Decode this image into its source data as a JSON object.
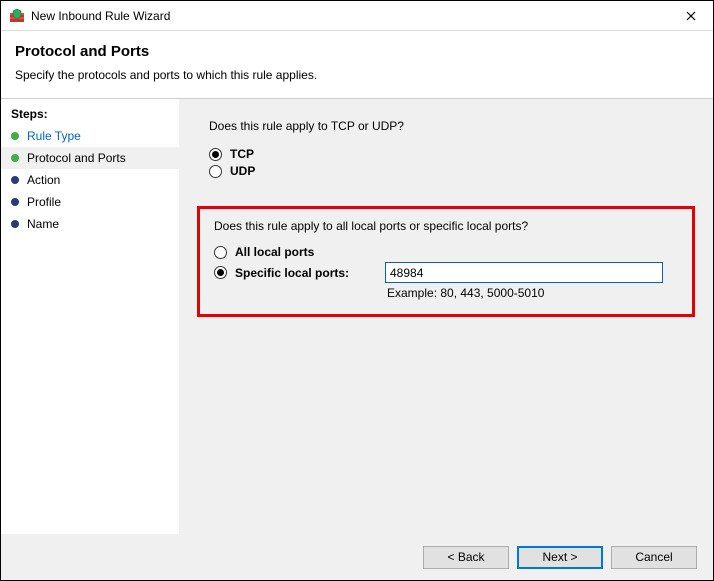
{
  "window": {
    "title": "New Inbound Rule Wizard"
  },
  "header": {
    "title": "Protocol and Ports",
    "subtitle": "Specify the protocols and ports to which this rule applies."
  },
  "sidebar": {
    "heading": "Steps:",
    "items": [
      {
        "label": "Rule Type",
        "state": "done",
        "link": true
      },
      {
        "label": "Protocol and Ports",
        "state": "done",
        "current": true
      },
      {
        "label": "Action",
        "state": "todo"
      },
      {
        "label": "Profile",
        "state": "todo"
      },
      {
        "label": "Name",
        "state": "todo"
      }
    ]
  },
  "main": {
    "q1": "Does this rule apply to TCP or UDP?",
    "protocol": {
      "tcp": "TCP",
      "udp": "UDP",
      "selected": "tcp"
    },
    "q2": "Does this rule apply to all local ports or specific local ports?",
    "ports": {
      "all_label": "All local ports",
      "specific_label": "Specific local ports:",
      "selected": "specific",
      "value": "48984",
      "example": "Example: 80, 443, 5000-5010"
    }
  },
  "footer": {
    "back": "< Back",
    "next": "Next >",
    "cancel": "Cancel"
  }
}
